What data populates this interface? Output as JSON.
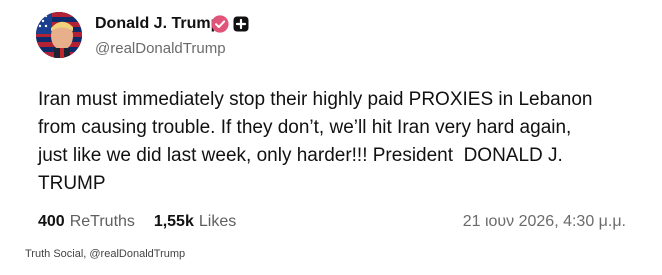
{
  "profile": {
    "display_name": "Donald J. Trump",
    "handle": "@realDonaldTrump",
    "verified_icon": "verified-badge-icon",
    "plus_icon": "plus-square-icon"
  },
  "post": {
    "text": "Iran must immediately stop their highly paid PROXIES in Lebanon\nfrom causing trouble. If they don’t, we’ll hit Iran very hard again,\njust like we did last week, only harder!!! President  DONALD J.\nTRUMP"
  },
  "stats": {
    "retruths_count": "400",
    "retruths_label": "ReTruths",
    "likes_count": "1,55k",
    "likes_label": "Likes",
    "timestamp": "21 ιουν 2026, 4:30 μ.μ."
  },
  "caption": "Truth Social, @realDonaldTrump",
  "colors": {
    "verified_badge": "#e0547a",
    "text": "#111111",
    "muted": "#6b6b6b"
  }
}
